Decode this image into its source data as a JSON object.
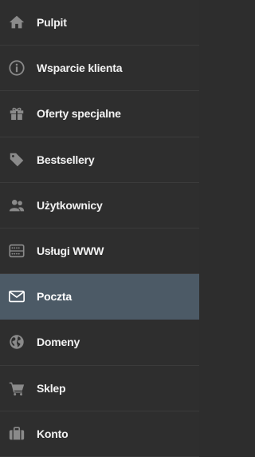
{
  "sidebar": {
    "items": [
      {
        "label": "Pulpit",
        "icon": "home-icon"
      },
      {
        "label": "Wsparcie klienta",
        "icon": "info-circle-icon"
      },
      {
        "label": "Oferty specjalne",
        "icon": "gift-icon"
      },
      {
        "label": "Bestsellery",
        "icon": "tag-icon"
      },
      {
        "label": "Użytkownicy",
        "icon": "users-icon"
      },
      {
        "label": "Usługi WWW",
        "icon": "server-icon"
      },
      {
        "label": "Poczta",
        "icon": "envelope-icon",
        "active": true
      },
      {
        "label": "Domeny",
        "icon": "globe-icon"
      },
      {
        "label": "Sklep",
        "icon": "cart-icon"
      },
      {
        "label": "Konto",
        "icon": "briefcase-icon"
      }
    ]
  },
  "colors": {
    "background": "#2e2e2e",
    "active_background": "#4c5a66",
    "icon": "#8a8a8a",
    "active_icon": "#ffffff",
    "text": "#f2f2f2"
  }
}
